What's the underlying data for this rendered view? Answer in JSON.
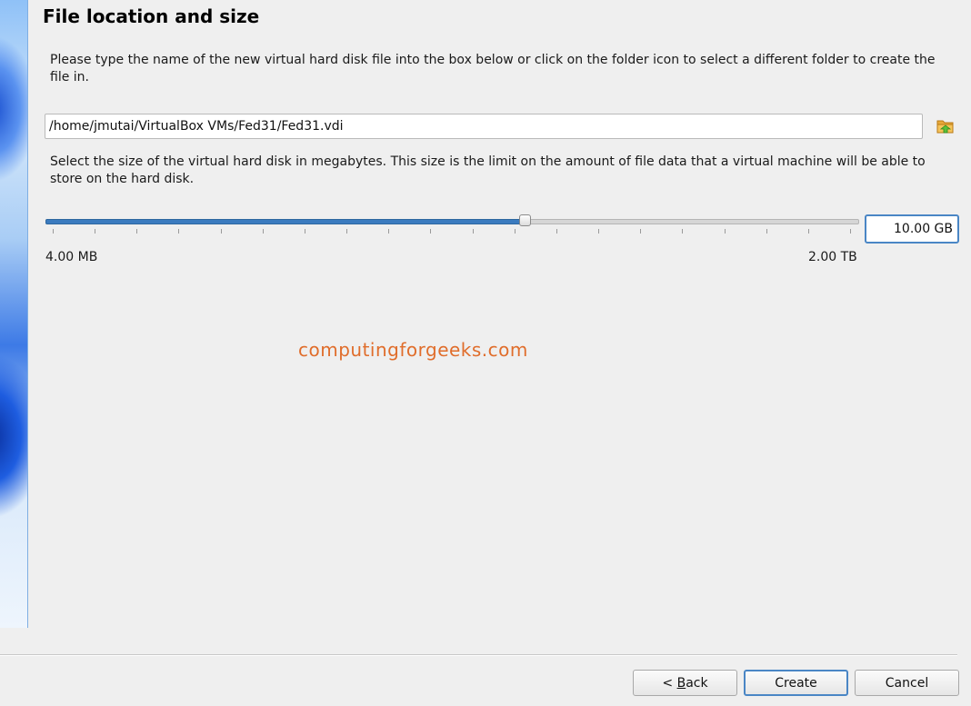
{
  "title": "File location and size",
  "location": {
    "description": "Please type the name of the new virtual hard disk file into the box below or click on the folder icon to select a different folder to create the file in.",
    "path_value": "/home/jmutai/VirtualBox VMs/Fed31/Fed31.vdi",
    "folder_icon": "folder-icon"
  },
  "size": {
    "description": "Select the size of the virtual hard disk in megabytes. This size is the limit on the amount of file data that a virtual machine will be able to store on the hard disk.",
    "value": "10.00 GB",
    "min_label": "4.00 MB",
    "max_label": "2.00 TB",
    "slider_fraction": 0.59
  },
  "watermark": "computingforgeeks.com",
  "buttons": {
    "back_prefix": "< ",
    "back_underlined": "B",
    "back_rest": "ack",
    "create": "Create",
    "cancel": "Cancel"
  },
  "colors": {
    "accent": "#4a86c5",
    "slider_fill": "#3b7bbf",
    "watermark": "#e06d2b"
  }
}
